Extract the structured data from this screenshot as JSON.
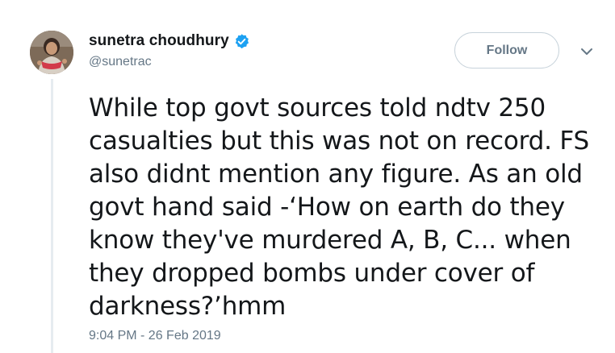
{
  "author": {
    "display_name": "sunetra choudhury",
    "handle": "@sunetrac",
    "verified_icon": "verified-badge-icon",
    "avatar_icon": "profile-photo"
  },
  "actions": {
    "follow_label": "Follow",
    "more_icon": "chevron-down-icon"
  },
  "tweet": {
    "text": "While top govt sources told ndtv 250\ncasualties but this was not on record. FS\nalso didnt mention any figure. As an old\ngovt hand said -‘How on earth do they\nknow they've murdered A, B, C... when\nthey dropped bombs under cover of\ndarkness?’hmm",
    "timestamp": "9:04 PM - 26 Feb 2019"
  },
  "colors": {
    "text_primary": "#14171a",
    "text_secondary": "#657786",
    "verified_blue": "#1da1f2",
    "border": "#c8d3db",
    "thread_line": "#e6ecf0"
  }
}
